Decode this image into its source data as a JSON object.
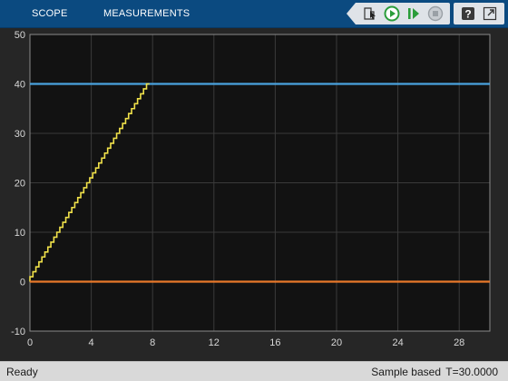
{
  "toolstrip": {
    "tabs": [
      {
        "label": "SCOPE"
      },
      {
        "label": "MEASUREMENTS"
      }
    ],
    "buttons": [
      {
        "name": "highlight-block-icon"
      },
      {
        "name": "run-icon"
      },
      {
        "name": "step-forward-icon"
      },
      {
        "name": "stop-icon"
      },
      {
        "name": "help-icon"
      },
      {
        "name": "undock-icon"
      }
    ],
    "colors": {
      "toolstrip_bg": "#0b4a80",
      "run_green": "#2a9d3a",
      "stop_gray": "#9aa0a6"
    }
  },
  "status": {
    "left": "Ready",
    "mode": "Sample based",
    "time": "T=30.0000"
  },
  "chart_data": {
    "type": "line",
    "title": "",
    "xlabel": "",
    "ylabel": "",
    "xlim": [
      0,
      30
    ],
    "ylim": [
      -10,
      50
    ],
    "x_ticks": [
      0,
      4,
      8,
      12,
      16,
      20,
      24,
      28
    ],
    "y_ticks": [
      -10,
      0,
      10,
      20,
      30,
      40,
      50
    ],
    "grid": true,
    "legend": "none",
    "background": "#121212",
    "series": [
      {
        "color": "#4aa3df",
        "style": "constant",
        "x": [
          0,
          30
        ],
        "y": [
          40,
          40
        ]
      },
      {
        "color": "#f0e14a",
        "style": "staircase",
        "x_start": 0,
        "x_end": 7.8,
        "y_start": 0,
        "y_end": 40,
        "step_count": 40
      },
      {
        "color": "#e8782a",
        "style": "constant",
        "x": [
          0,
          30
        ],
        "y": [
          0,
          0
        ]
      }
    ]
  }
}
